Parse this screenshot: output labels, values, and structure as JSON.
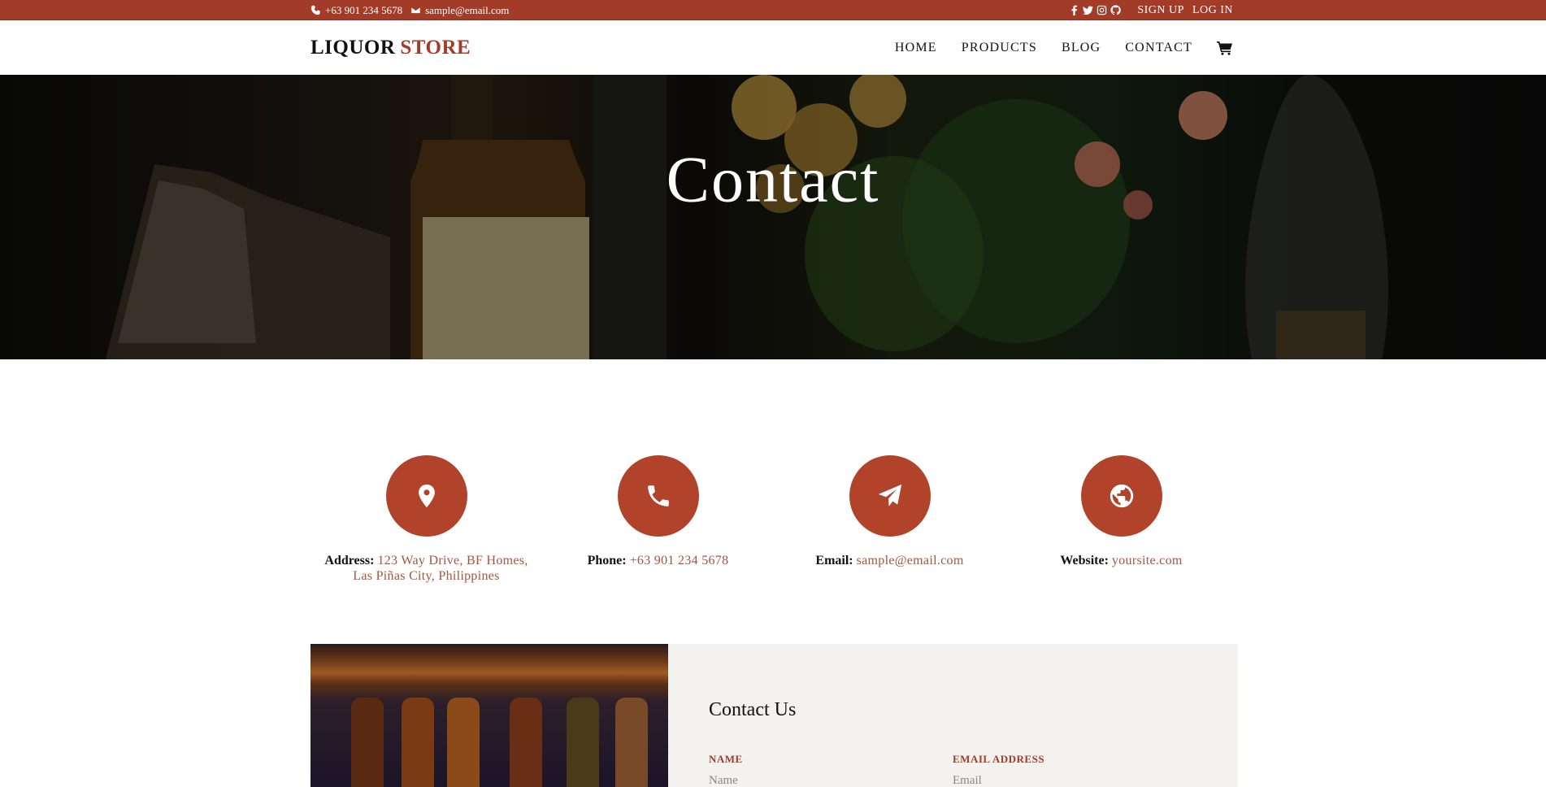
{
  "topbar": {
    "phone": "+63 901 234 5678",
    "email": "sample@email.com",
    "socials": [
      "facebook-icon",
      "twitter-icon",
      "instagram-icon",
      "github-icon"
    ],
    "signup": "SIGN UP",
    "login": "LOG IN",
    "bg_color": "#a23b27"
  },
  "nav": {
    "logo_word1": "LIQUOR",
    "logo_word2": "STORE",
    "items": [
      {
        "label": "HOME"
      },
      {
        "label": "PRODUCTS"
      },
      {
        "label": "BLOG"
      },
      {
        "label": "CONTACT"
      }
    ],
    "cart_icon": "shopping-cart-icon"
  },
  "hero": {
    "title": "Contact"
  },
  "info": [
    {
      "icon": "map-pin-icon",
      "label": "Address:",
      "value": "123 Way Drive, BF Homes,",
      "value2": "Las Piñas City, Philippines"
    },
    {
      "icon": "phone-icon",
      "label": "Phone:",
      "value": "+63 901 234 5678"
    },
    {
      "icon": "paper-plane-icon",
      "label": "Email:",
      "value": "sample@email.com"
    },
    {
      "icon": "globe-icon",
      "label": "Website:",
      "value": "yoursite.com"
    }
  ],
  "contact_form": {
    "title": "Contact Us",
    "name_label": "NAME",
    "name_placeholder": "Name",
    "email_label": "EMAIL ADDRESS",
    "email_placeholder": "Email"
  },
  "colors": {
    "accent": "#b0432a",
    "link": "#a4553f",
    "panel_bg": "#f4f2ef"
  }
}
